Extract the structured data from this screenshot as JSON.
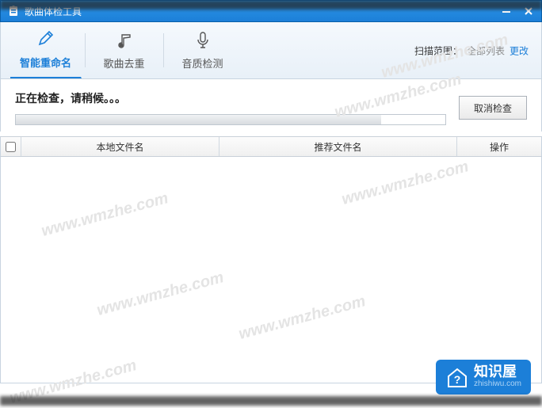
{
  "titlebar": {
    "title": "歌曲体检工具"
  },
  "tabs": {
    "rename": "智能重命名",
    "dedup": "歌曲去重",
    "quality": "音质检测"
  },
  "scan": {
    "label": "扫描范围：",
    "value": "全部列表",
    "change": "更改"
  },
  "status": {
    "text": "正在检查，请稍候。。。",
    "cancel": "取消检查"
  },
  "columns": {
    "local": "本地文件名",
    "recommend": "推荐文件名",
    "action": "操作"
  },
  "watermark": "www.wmzhe.com",
  "brand": {
    "cn": "知识屋",
    "en": "zhishiwu.com"
  }
}
